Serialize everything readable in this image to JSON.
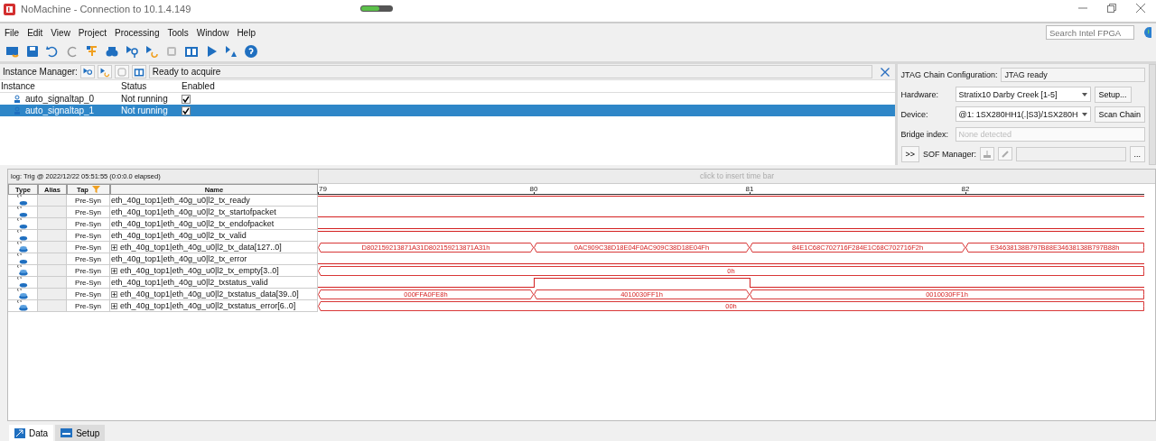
{
  "title_bar": {
    "title": "NoMachine - Connection to 10.1.4.149",
    "meter": {
      "level": 0.6
    }
  },
  "menu": [
    "File",
    "Edit",
    "View",
    "Project",
    "Processing",
    "Tools",
    "Window",
    "Help"
  ],
  "search": {
    "placeholder": "Search Intel FPGA"
  },
  "instance_manager": {
    "label": "Instance Manager:",
    "status": "Ready to acquire",
    "columns": [
      "Instance",
      "Status",
      "Enabled"
    ],
    "rows": [
      {
        "instance": "auto_signaltap_0",
        "status": "Not running",
        "checked": true,
        "selected": false
      },
      {
        "instance": "auto_signaltap_1",
        "status": "Not running",
        "checked": true,
        "selected": true
      }
    ]
  },
  "jtag": {
    "label": "JTAG Chain Configuration:",
    "status": "JTAG ready",
    "hardware_label": "Hardware:",
    "hardware": "Stratix10 Darby Creek [1-5]",
    "setup_button": "Setup...",
    "device_label": "Device:",
    "device": "@1: 1SX280HH1(.|S3)/1SX280H",
    "scan_button": "Scan Chain",
    "bridge_label": "Bridge index:",
    "bridge": "None detected",
    "expand_button": ">>",
    "sof_label": "SOF Manager:",
    "browse_button": "..."
  },
  "waveform": {
    "log": "log: Trig @ 2022/12/22 05:51:55 (0:0:0.0 elapsed)",
    "time_bar_hint": "click to insert time bar",
    "columns": [
      "Type",
      "Alias",
      "Tap",
      "Name"
    ],
    "ticks": [
      "79",
      "80",
      "81",
      "82"
    ],
    "signals": [
      {
        "kind": "bit",
        "tap": "Pre-Syn",
        "name": "eth_40g_top1|eth_40g_u0|l2_tx_ready",
        "expandable": false,
        "high": [
          true,
          true,
          true,
          true
        ]
      },
      {
        "kind": "bit",
        "tap": "Pre-Syn",
        "name": "eth_40g_top1|eth_40g_u0|l2_tx_startofpacket",
        "expandable": false,
        "high": [
          false,
          false,
          false,
          false
        ]
      },
      {
        "kind": "bit",
        "tap": "Pre-Syn",
        "name": "eth_40g_top1|eth_40g_u0|l2_tx_endofpacket",
        "expandable": false,
        "high": [
          false,
          false,
          false,
          false
        ]
      },
      {
        "kind": "bit",
        "tap": "Pre-Syn",
        "name": "eth_40g_top1|eth_40g_u0|l2_tx_valid",
        "expandable": false,
        "high": [
          true,
          true,
          true,
          true
        ]
      },
      {
        "kind": "bus",
        "tap": "Pre-Syn",
        "name": "eth_40g_top1|eth_40g_u0|l2_tx_data[127..0]",
        "expandable": true,
        "transitions": [
          false,
          true,
          true,
          true
        ],
        "values": [
          "D802159213871A31D802159213871A31h",
          "0AC909C38D18E04F0AC909C38D18E04Fh",
          "84E1C68C702716F284E1C68C702716F2h",
          "E34638138B797B88E34638138B797B88h"
        ]
      },
      {
        "kind": "bit",
        "tap": "Pre-Syn",
        "name": "eth_40g_top1|eth_40g_u0|l2_tx_error",
        "expandable": false,
        "high": [
          false,
          false,
          false,
          false
        ]
      },
      {
        "kind": "bus",
        "tap": "Pre-Syn",
        "name": "eth_40g_top1|eth_40g_u0|l2_tx_empty[3..0]",
        "expandable": true,
        "transitions": [
          false,
          false,
          false,
          false
        ],
        "values": [
          "0h"
        ]
      },
      {
        "kind": "bit",
        "tap": "Pre-Syn",
        "name": "eth_40g_top1|eth_40g_u0|l2_txstatus_valid",
        "expandable": false,
        "high": [
          false,
          true,
          false,
          false
        ]
      },
      {
        "kind": "bus",
        "tap": "Pre-Syn",
        "name": "eth_40g_top1|eth_40g_u0|l2_txstatus_data[39..0]",
        "expandable": true,
        "transitions": [
          false,
          true,
          true,
          false
        ],
        "values": [
          "000FFA0FE8h",
          "4010030FF1h",
          "0010030FF1h"
        ]
      },
      {
        "kind": "bus",
        "tap": "Pre-Syn",
        "name": "eth_40g_top1|eth_40g_u0|l2_txstatus_error[6..0]",
        "expandable": true,
        "transitions": [
          false,
          false,
          false,
          false
        ],
        "values": [
          "00h"
        ]
      }
    ]
  },
  "bottom_tabs": [
    {
      "label": "Data",
      "selected": true
    },
    {
      "label": "Setup",
      "selected": false
    }
  ]
}
